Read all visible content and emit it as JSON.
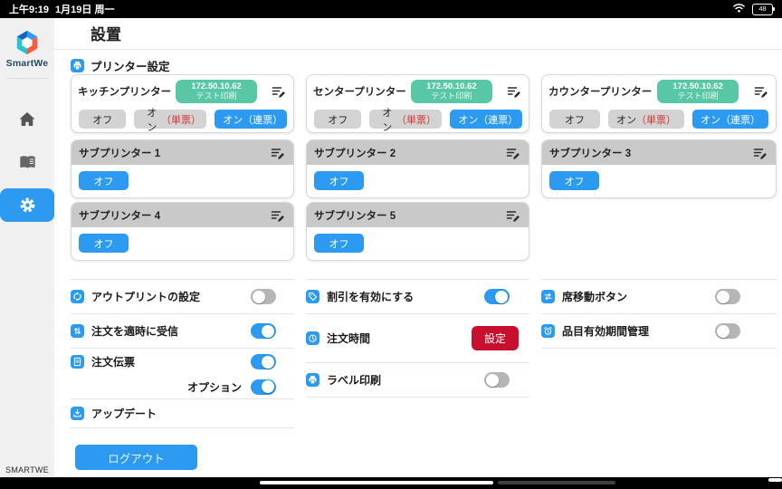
{
  "status_bar": {
    "time": "上午9:19",
    "date": "1月19日 周一",
    "battery_percent": "48"
  },
  "sidebar": {
    "brand": "SmartWe",
    "footer_brand": "SMARTWE"
  },
  "page": {
    "title": "設置"
  },
  "printer_section": {
    "label": "プリンター設定",
    "accent_color": "#2b9af0",
    "badge_color": "#58c7a6",
    "main_printers": [
      {
        "name": "キッチンプリンター",
        "ip": "172.50.10.62",
        "badge_action": "テスト印刷",
        "off": "オフ",
        "on_single_prefix": "オン",
        "on_single_suffix": "（単票）",
        "on_multi": "オン（連票）",
        "selected": "オン（連票）"
      },
      {
        "name": "センタープリンター",
        "ip": "172.50.10.62",
        "badge_action": "テスト印刷",
        "off": "オフ",
        "on_single_prefix": "オン",
        "on_single_suffix": "（単票）",
        "on_multi": "オン（連票）",
        "selected": "オン（連票）"
      },
      {
        "name": "カウンタープリンター",
        "ip": "172.50.10.62",
        "badge_action": "テスト印刷",
        "off": "オフ",
        "on_single_prefix": "オン",
        "on_single_suffix": "（単票）",
        "on_multi": "オン（連票）",
        "selected": "オン（連票）"
      }
    ],
    "sub_printers": [
      {
        "name": "サブプリンター 1",
        "off": "オフ"
      },
      {
        "name": "サブプリンター 2",
        "off": "オフ"
      },
      {
        "name": "サブプリンター 3",
        "off": "オフ"
      },
      {
        "name": "サブプリンター 4",
        "off": "オフ"
      },
      {
        "name": "サブプリンター 5",
        "off": "オフ"
      }
    ]
  },
  "settings": {
    "left_rows": [
      {
        "icon": "sync-icon",
        "label": "アウトプリントの設定",
        "toggle": "off"
      },
      {
        "icon": "updown-arrows-icon",
        "label": "注文を適時に受信",
        "toggle": "on"
      },
      {
        "icon": "receipt-icon",
        "label": "注文伝票",
        "toggle": "on"
      },
      {
        "icon": "",
        "label": "オプション",
        "toggle": "on"
      },
      {
        "icon": "download-icon",
        "label": "アップデート"
      }
    ],
    "middle_rows": [
      {
        "icon": "discount-tag-icon",
        "label": "割引を有効にする",
        "toggle": "on"
      },
      {
        "icon": "clock-icon",
        "label": "注文時間",
        "button": "設定",
        "button_color": "#c8102e"
      },
      {
        "icon": "label-printer-icon",
        "label": "ラベル印刷",
        "toggle": "off"
      }
    ],
    "right_rows": [
      {
        "icon": "seat-move-icon",
        "label": "席移動ボタン",
        "toggle": "off"
      },
      {
        "icon": "alarm-clock-icon",
        "label": "品目有効期間管理",
        "toggle": "off"
      }
    ],
    "logout_label": "ログアウト"
  }
}
